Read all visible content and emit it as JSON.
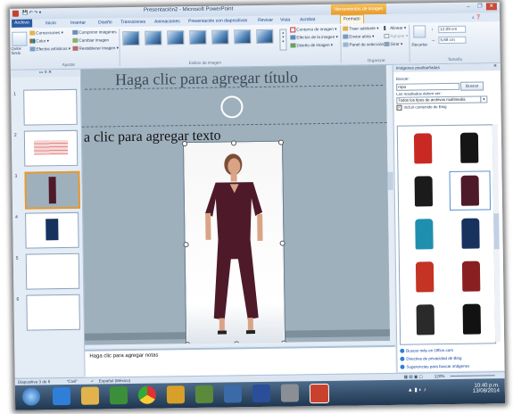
{
  "window": {
    "title": "Presentación2 - Microsoft PowerPoint",
    "context_tab": "Herramientas de imagen",
    "controls": [
      "–",
      "❐",
      "✕"
    ]
  },
  "tabs": [
    "Archivo",
    "Inicio",
    "Insertar",
    "Diseño",
    "Transiciones",
    "Animaciones",
    "Presentación con diapositivas",
    "Revisar",
    "Vista",
    "Acrobat",
    "Formato"
  ],
  "ribbon": {
    "quitar_fondo": "Quitar fondo",
    "ajustar": {
      "items": [
        "Correcciones ▾",
        "Color ▾",
        "Efectos artísticos ▾"
      ],
      "right_items": [
        "Comprimir imágenes",
        "Cambiar imagen",
        "Restablecer imagen ▾"
      ],
      "label": "Ajustar"
    },
    "estilos": {
      "label": "Estilos de imagen",
      "thumb_count": 7
    },
    "estilos_right": [
      "Contorno de imagen ▾",
      "Efectos de la imagen ▾",
      "Diseño de imagen ▾"
    ],
    "organizar": {
      "items": [
        "Traer adelante ▾",
        "Enviar atrás ▾",
        "Panel de selección"
      ],
      "right_items": [
        "Alinear ▾",
        "Agrupar ▾",
        "Girar ▾"
      ],
      "label": "Organizar"
    },
    "tamano": {
      "recortar": "Recortar",
      "height": "12,09 cm",
      "width": "5,68 cm",
      "label": "Tamaño"
    }
  },
  "slides": {
    "numbers": [
      "1",
      "2",
      "3",
      "4",
      "5",
      "6"
    ],
    "selected": "3"
  },
  "slide": {
    "title_placeholder": "Haga clic para agregar título",
    "content_placeholder": "a clic para agregar texto"
  },
  "notes": {
    "placeholder": "Haga clic para agregar notas"
  },
  "taskpane": {
    "title": "Imágenes prediseñadas",
    "buscar_label": "Buscar:",
    "search_value": "ropa",
    "search_button": "Buscar",
    "results_label": "Los resultados deben ser:",
    "filter_value": "Todos los tipos de archivos multimedia",
    "include_bing": "Incluir contenido de Bing",
    "include_bing_checked": true,
    "links": [
      "Buscar más en Office.com",
      "Directiva de privacidad de Bing",
      "Sugerencias para buscar imágenes"
    ]
  },
  "status": {
    "slide_info": "Diapositiva 3 de 6",
    "theme": "\"Civil\"",
    "language": "Español (México)",
    "zoom": "120%"
  },
  "taskbar": {
    "time": "10:40 p.m.",
    "date": "13/08/2014"
  },
  "colors": {
    "accent": "#e79a2c",
    "ribbon_text": "#1e395b",
    "slide_bg": "#9fb0bd",
    "dress": "#4e1a2a"
  },
  "images": [
    {
      "label": "red jacket",
      "color": "#c82a23"
    },
    {
      "label": "black t-shirt",
      "color": "#151515"
    },
    {
      "label": "black pants",
      "color": "#1b1b1b"
    },
    {
      "label": "woman in maroon jumpsuit",
      "color": "#4e1a2a"
    },
    {
      "label": "blue sweater",
      "color": "#1f8fb0"
    },
    {
      "label": "navy sweater",
      "color": "#17325d"
    },
    {
      "label": "red outfit set",
      "color": "#c43323"
    },
    {
      "label": "red dress",
      "color": "#8a1f22"
    },
    {
      "label": "woman outfit",
      "color": "#2a2a2a"
    },
    {
      "label": "LOVE t-shirt",
      "color": "#121212"
    }
  ]
}
